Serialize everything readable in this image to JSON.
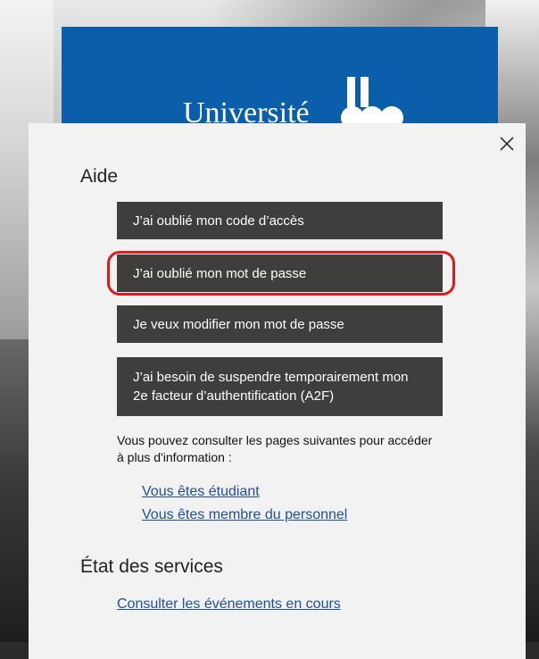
{
  "brand": {
    "name": "Université",
    "color": "#0b5faa"
  },
  "modal": {
    "close_icon": "close-icon",
    "help_section": {
      "title": "Aide",
      "buttons": [
        {
          "label": "J’ai oublié mon code d’accès"
        },
        {
          "label": "J’ai oublié mon mot de passe"
        },
        {
          "label": "Je veux modifier mon mot de passe"
        },
        {
          "label": "J’ai besoin de suspendre temporairement mon 2e facteur d’authentification (A2F)"
        }
      ],
      "info_text": "Vous pouvez consulter les pages suivantes pour accéder à plus d'information :",
      "links": [
        {
          "label": "Vous êtes étudiant"
        },
        {
          "label": "Vous êtes membre du personnel"
        }
      ]
    },
    "status_section": {
      "title": "État des services",
      "link": "Consulter les événements en cours"
    }
  },
  "colors": {
    "button_bg": "#3f3e3d",
    "link": "#1f4fa3",
    "highlight": "#e0191f",
    "modal_bg": "#f2f2f2"
  }
}
